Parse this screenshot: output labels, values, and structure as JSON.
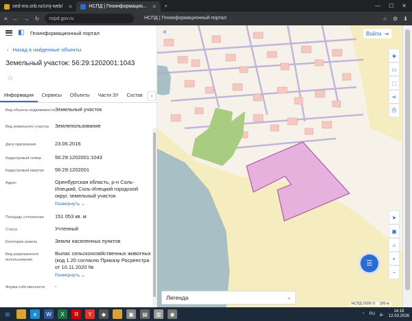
{
  "browser": {
    "tabs": [
      {
        "label": "sed-mo.orb.ru/cmj-web/",
        "icon_color": "#e0a030"
      },
      {
        "label": "НСПД | Геоинформацио...",
        "icon_color": "#2b6cd4"
      }
    ],
    "new_tab": "+",
    "url": "nspd.gov.ru",
    "page_title": "НСПД | Геоинформационный портал"
  },
  "app": {
    "brand": "Геоинформационный портал",
    "back_label": "Назад в найденные объекты",
    "title": "Земельный участок: 56:29:1202001:1043",
    "tabs": [
      "Информация",
      "Сервисы",
      "Объекты",
      "Части ЗУ",
      "Состав"
    ],
    "fields": [
      {
        "label": "Вид объекта недвижимости",
        "value": "Земельный участок"
      },
      {
        "label": "Вид земельного участка",
        "value": "Землепользование"
      },
      {
        "label": "Дата присвоения",
        "value": "23.06.2016"
      },
      {
        "label": "Кадастровый номер",
        "value": "56:29:1202001:1043"
      },
      {
        "label": "Кадастровый квартал",
        "value": "56:29:1202001"
      },
      {
        "label": "Адрес",
        "value": "Оренбургская область, р-н Соль-Илецкий, Соль-Илецкий городской округ, земельный участок",
        "expand": "Развернуть"
      },
      {
        "label": "Площадь уточненная",
        "value": "151 053 кв. м"
      },
      {
        "label": "Статус",
        "value": "Учтенный"
      },
      {
        "label": "Категория земель",
        "value": "Земли населенных пунктов"
      },
      {
        "label": "Вид разрешенного использования",
        "value": "Выпас сельскохозяйственных животных (код 1.20 согласно Приказу Росреестра от 10.11.2020 №",
        "expand": "Развернуть"
      },
      {
        "label": "Форма собственности",
        "value": "-"
      }
    ],
    "login_label": "Войти",
    "legend_label": "Легенда",
    "attribution": "НСПД 2026 ©",
    "scale": "100 м"
  },
  "taskbar": {
    "lang": "RU",
    "time": "14:18",
    "date": "12.03.2026"
  }
}
